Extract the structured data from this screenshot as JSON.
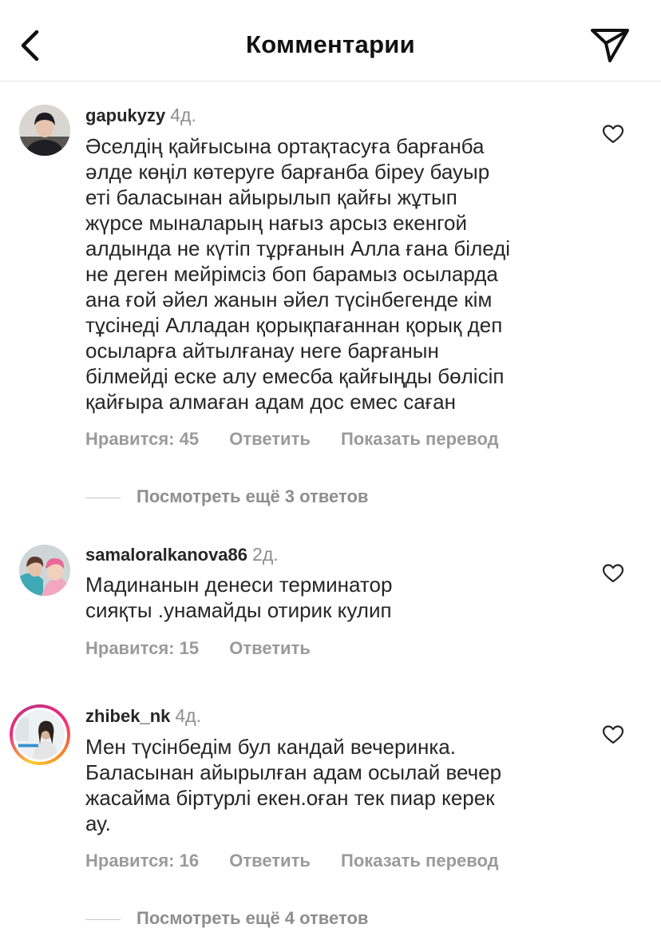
{
  "header": {
    "title": "Комментарии"
  },
  "comments": [
    {
      "username": "gapukyzy",
      "time": "4д.",
      "lines": [
        "Әселдің қайғысына ортақтасуға барғанба",
        "әлде көңіл көтеруге барғанба біреу бауыр",
        "еті баласынан айырылып қайғы жұтып",
        "жүрсе мыналарың нағыз арсыз екенгой",
        "алдында не күтіп тұрғанын Алла ғана біледі",
        "не деген мейрімсіз боп барамыз осыларда",
        "ана ғой әйел жанын әйел түсінбегенде кім",
        "тұсінеді Алладан қорықпағаннан қорық деп",
        "осыларға айтылғанау неге барғанын",
        "білмейді еске алу емесба қайғыңды бөлісіп",
        "қайғыра алмаған адам дос емес саған"
      ],
      "likes": "Нравится: 45",
      "reply": "Ответить",
      "translate": "Показать перевод",
      "more_replies": "Посмотреть ещё 3 ответов"
    },
    {
      "username": "samaloralkanova86",
      "time": "2д.",
      "lines": [
        "Мадинанын денеси терминатор",
        "сияқты .унамайды отирик кулип"
      ],
      "likes": "Нравится: 15",
      "reply": "Ответить"
    },
    {
      "username": "zhibek_nk",
      "time": "4д.",
      "lines": [
        "Мен түсінбедім бул кандай вечеринка.",
        "Баласынан айырылған адам осылай вечер",
        "жасайма біртурлі екен.оған тек пиар керек",
        "ау."
      ],
      "likes": "Нравится: 16",
      "reply": "Ответить",
      "translate": "Показать перевод",
      "more_replies": "Посмотреть ещё 4 ответов"
    }
  ]
}
